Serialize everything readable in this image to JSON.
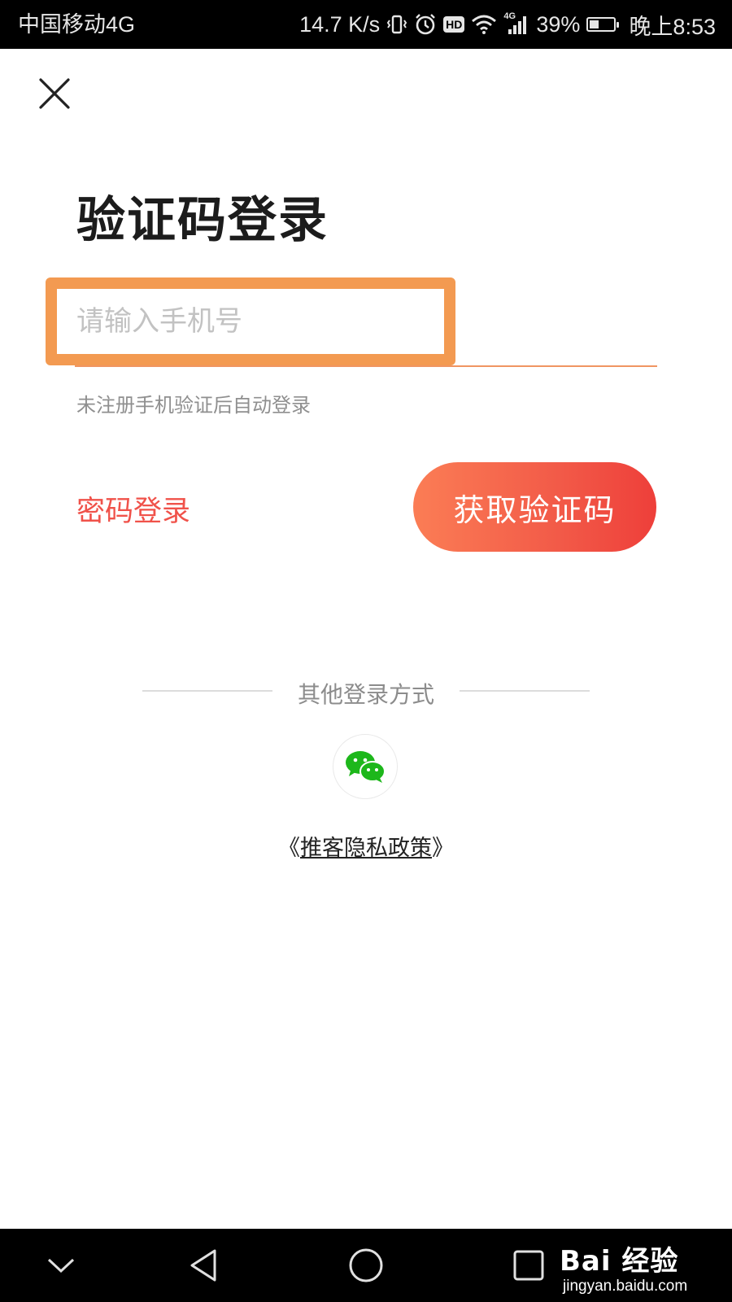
{
  "status_bar": {
    "carrier": "中国移动4G",
    "speed": "14.7 K/s",
    "hd": "HD",
    "network": "4G",
    "battery": "39%",
    "battery_level": 0.39,
    "time": "晚上8:53"
  },
  "header": {
    "close_icon": "close-icon"
  },
  "login": {
    "title": "验证码登录",
    "phone_placeholder": "请输入手机号",
    "hint": "未注册手机验证后自动登录",
    "password_login": "密码登录",
    "get_code": "获取验证码",
    "highlight_color": "#f39a51",
    "accent_color": "#f0524a"
  },
  "other_login": {
    "label": "其他登录方式",
    "wechat_icon": "wechat-icon"
  },
  "privacy": {
    "open": "《",
    "link": "推客隐私政策",
    "close": "》"
  },
  "nav": {
    "down_icon": "chevron-down-icon",
    "back_icon": "back-triangle-icon",
    "home_icon": "home-circle-icon",
    "recent_icon": "recent-square-icon"
  },
  "watermark": {
    "brand": "Bai 经验",
    "url": "jingyan.baidu.com"
  }
}
